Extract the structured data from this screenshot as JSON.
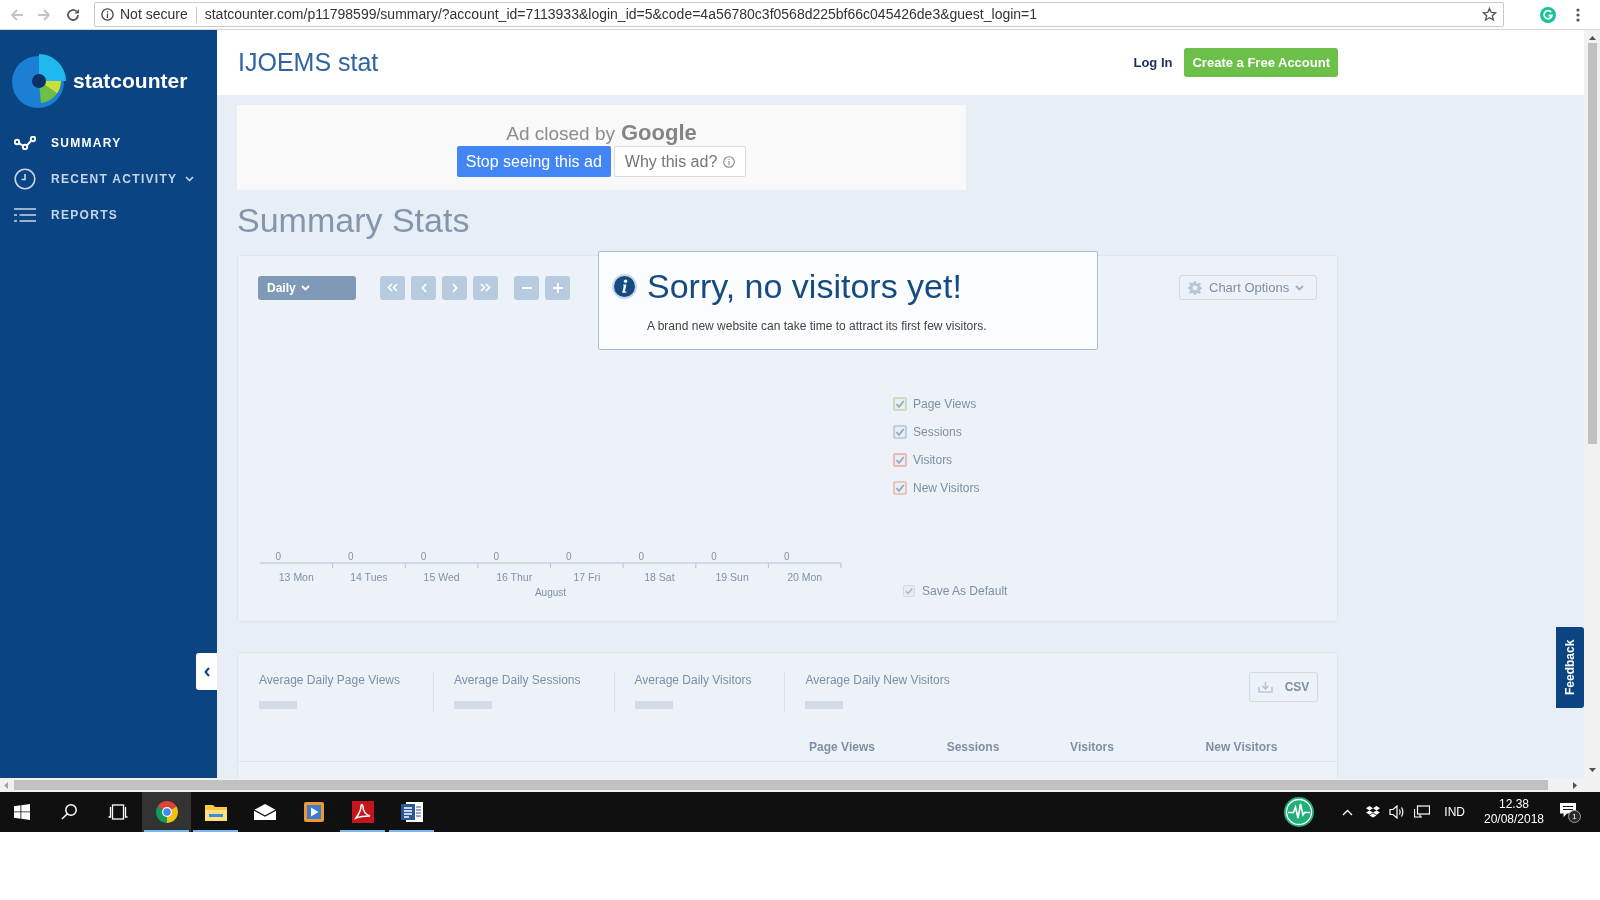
{
  "browser": {
    "back_disabled": true,
    "forward_disabled": true,
    "security": "Not secure",
    "url": "statcounter.com/p11798599/summary/?account_id=7113933&login_id=5&code=4a56780c3f0568d225bf66c045426de3&guest_login=1"
  },
  "sidebar": {
    "logo": "statcounter",
    "items": [
      {
        "kind": "summary",
        "label": "SUMMARY",
        "selected": true,
        "submenu": false
      },
      {
        "kind": "activity",
        "label": "RECENT ACTIVITY",
        "selected": false,
        "submenu": true
      },
      {
        "kind": "reports",
        "label": "REPORTS",
        "selected": false,
        "submenu": false
      }
    ]
  },
  "header": {
    "title": "IJOEMS stat",
    "login": "Log In",
    "signup": "Create a Free Account"
  },
  "ad": {
    "notice": "Ad closed by",
    "brand": "Google",
    "stop": "Stop seeing this ad",
    "why": "Why this ad?"
  },
  "page_title": "Summary Stats",
  "chart_panel": {
    "period": "Daily",
    "options": "Chart Options",
    "timeline": {
      "days": [
        {
          "label": "13 Mon",
          "count": "0"
        },
        {
          "label": "14 Tues",
          "count": "0"
        },
        {
          "label": "15 Wed",
          "count": "0"
        },
        {
          "label": "16 Thur",
          "count": "0"
        },
        {
          "label": "17 Fri",
          "count": "0"
        },
        {
          "label": "18 Sat",
          "count": "0"
        },
        {
          "label": "19 Sun",
          "count": "0"
        },
        {
          "label": "20 Mon",
          "count": "0"
        }
      ],
      "month": "August"
    },
    "series_toggles": [
      {
        "label": "Page Views",
        "checked": true,
        "color": "#c2e0bc"
      },
      {
        "label": "Sessions",
        "checked": true,
        "color": "#b6d2ec"
      },
      {
        "label": "Visitors",
        "checked": true,
        "color": "#ebb9b9"
      },
      {
        "label": "New Visitors",
        "checked": true,
        "color": "#eac8bd"
      }
    ],
    "save_default": {
      "label": "Save As Default",
      "checked": true
    }
  },
  "notice": {
    "title": "Sorry, no visitors yet!",
    "message": "A brand new website can take time to attract its first few visitors."
  },
  "summary_panel": {
    "metrics": [
      "Average Daily Page Views",
      "Average Daily Sessions",
      "Average Daily Visitors",
      "Average Daily New Visitors"
    ],
    "export": "CSV",
    "columns": [
      "Page Views",
      "Sessions",
      "Visitors",
      "New Visitors"
    ]
  },
  "feedback": "Feedback",
  "taskbar": {
    "apps": [
      {
        "kind": "browser",
        "selected": true,
        "running": true
      },
      {
        "kind": "folder",
        "selected": false,
        "running": true
      },
      {
        "kind": "mail",
        "selected": false,
        "running": false
      },
      {
        "kind": "media",
        "selected": false,
        "running": false
      },
      {
        "kind": "pdf",
        "selected": false,
        "running": true
      },
      {
        "kind": "word",
        "selected": false,
        "running": true
      }
    ],
    "language": "IND",
    "time": "12.38",
    "date": "20/08/2018",
    "notifications": "1"
  }
}
